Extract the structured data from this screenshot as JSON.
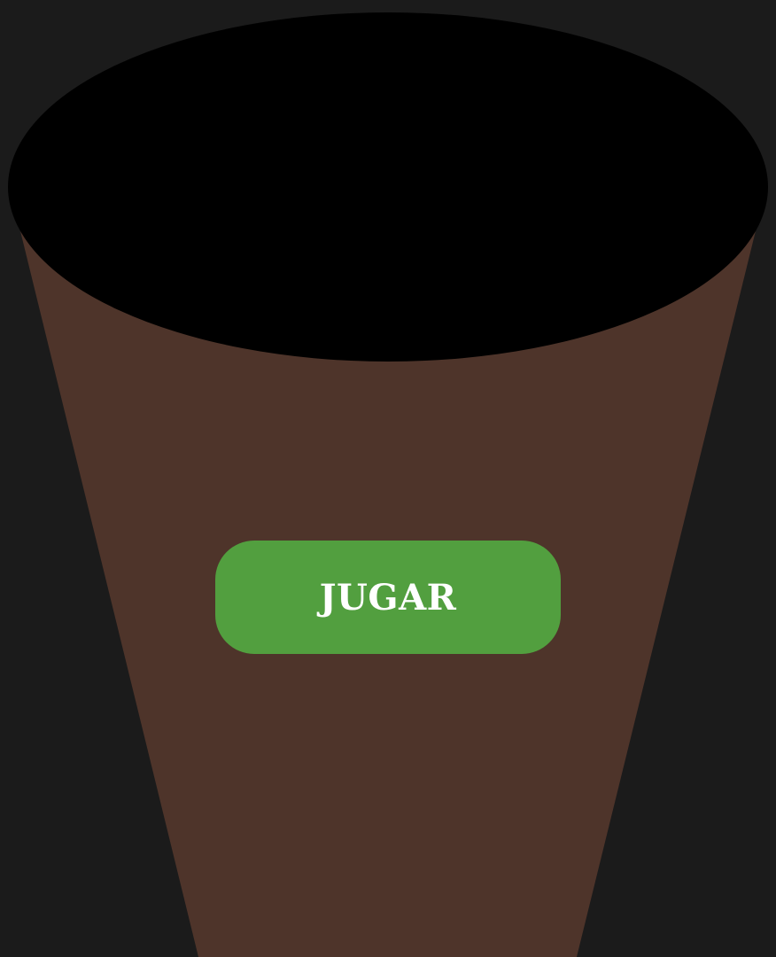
{
  "game": {
    "play_label": "JUGAR"
  },
  "colors": {
    "background": "#1b1b1b",
    "cup": "#4e342a",
    "cup_opening": "#000000",
    "play_button": "#529f3f",
    "play_button_text": "#ffffff"
  }
}
